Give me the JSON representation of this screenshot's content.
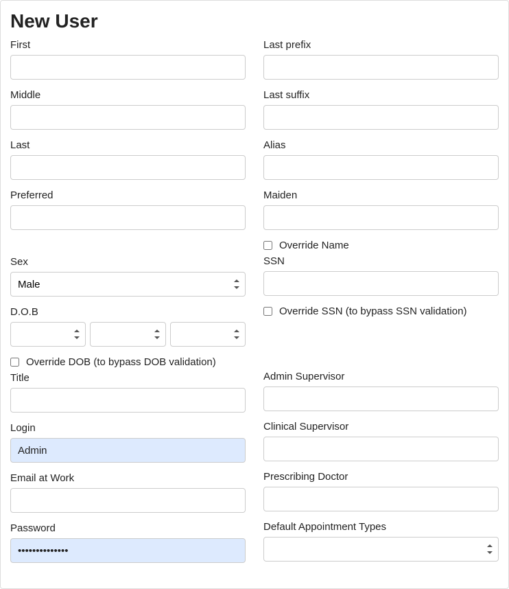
{
  "title": "New User",
  "left": {
    "first": {
      "label": "First",
      "value": ""
    },
    "middle": {
      "label": "Middle",
      "value": ""
    },
    "last": {
      "label": "Last",
      "value": ""
    },
    "preferred": {
      "label": "Preferred",
      "value": ""
    },
    "sex": {
      "label": "Sex",
      "value": "Male"
    },
    "dob": {
      "label": "D.O.B",
      "month": "",
      "day": "",
      "year": ""
    },
    "override_dob": {
      "label": "Override DOB (to bypass DOB validation)",
      "checked": false
    },
    "title_field": {
      "label": "Title",
      "value": ""
    },
    "login": {
      "label": "Login",
      "value": "Admin"
    },
    "email_work": {
      "label": "Email at Work",
      "value": ""
    },
    "password": {
      "label": "Password",
      "value": "••••••••••••••"
    }
  },
  "right": {
    "last_prefix": {
      "label": "Last prefix",
      "value": ""
    },
    "last_suffix": {
      "label": "Last suffix",
      "value": ""
    },
    "alias": {
      "label": "Alias",
      "value": ""
    },
    "maiden": {
      "label": "Maiden",
      "value": ""
    },
    "override_name": {
      "label": "Override Name",
      "checked": false
    },
    "ssn": {
      "label": "SSN",
      "value": ""
    },
    "override_ssn": {
      "label": "Override SSN (to bypass SSN validation)",
      "checked": false
    },
    "admin_supervisor": {
      "label": "Admin Supervisor",
      "value": ""
    },
    "clinical_supervisor": {
      "label": "Clinical Supervisor",
      "value": ""
    },
    "prescribing_doctor": {
      "label": "Prescribing Doctor",
      "value": ""
    },
    "default_appt_types": {
      "label": "Default Appointment Types",
      "value": ""
    }
  }
}
